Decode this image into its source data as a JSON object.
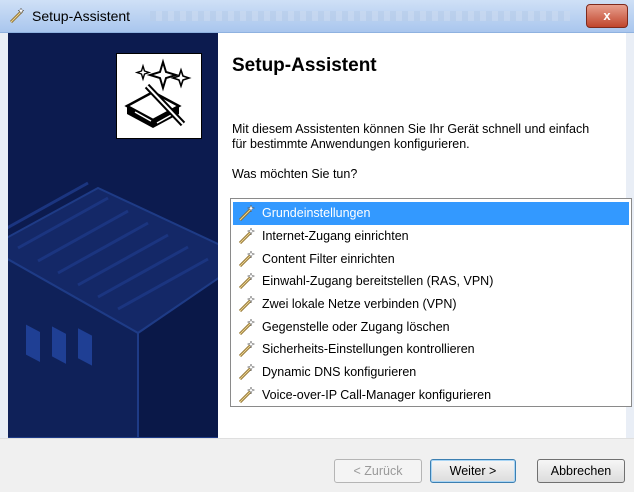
{
  "window": {
    "title": "Setup-Assistent",
    "close_label": "x"
  },
  "main": {
    "heading": "Setup-Assistent",
    "description": "Mit diesem Assistenten können Sie Ihr Gerät schnell und einfach für bestimmte Anwendungen konfigurieren.",
    "question": "Was möchten Sie tun?",
    "options": [
      "Grundeinstellungen",
      "Internet-Zugang einrichten",
      "Content Filter einrichten",
      "Einwahl-Zugang bereitstellen (RAS, VPN)",
      "Zwei lokale Netze verbinden (VPN)",
      "Gegenstelle oder Zugang löschen",
      "Sicherheits-Einstellungen kontrollieren",
      "Dynamic DNS konfigurieren",
      "Voice-over-IP Call-Manager konfigurieren"
    ],
    "selected_index": 0
  },
  "footer": {
    "back_label": "< Zurück",
    "next_label": "Weiter >",
    "cancel_label": "Abbrechen"
  },
  "colors": {
    "sidebar": "#0c1b4f",
    "selection": "#3399ff"
  }
}
